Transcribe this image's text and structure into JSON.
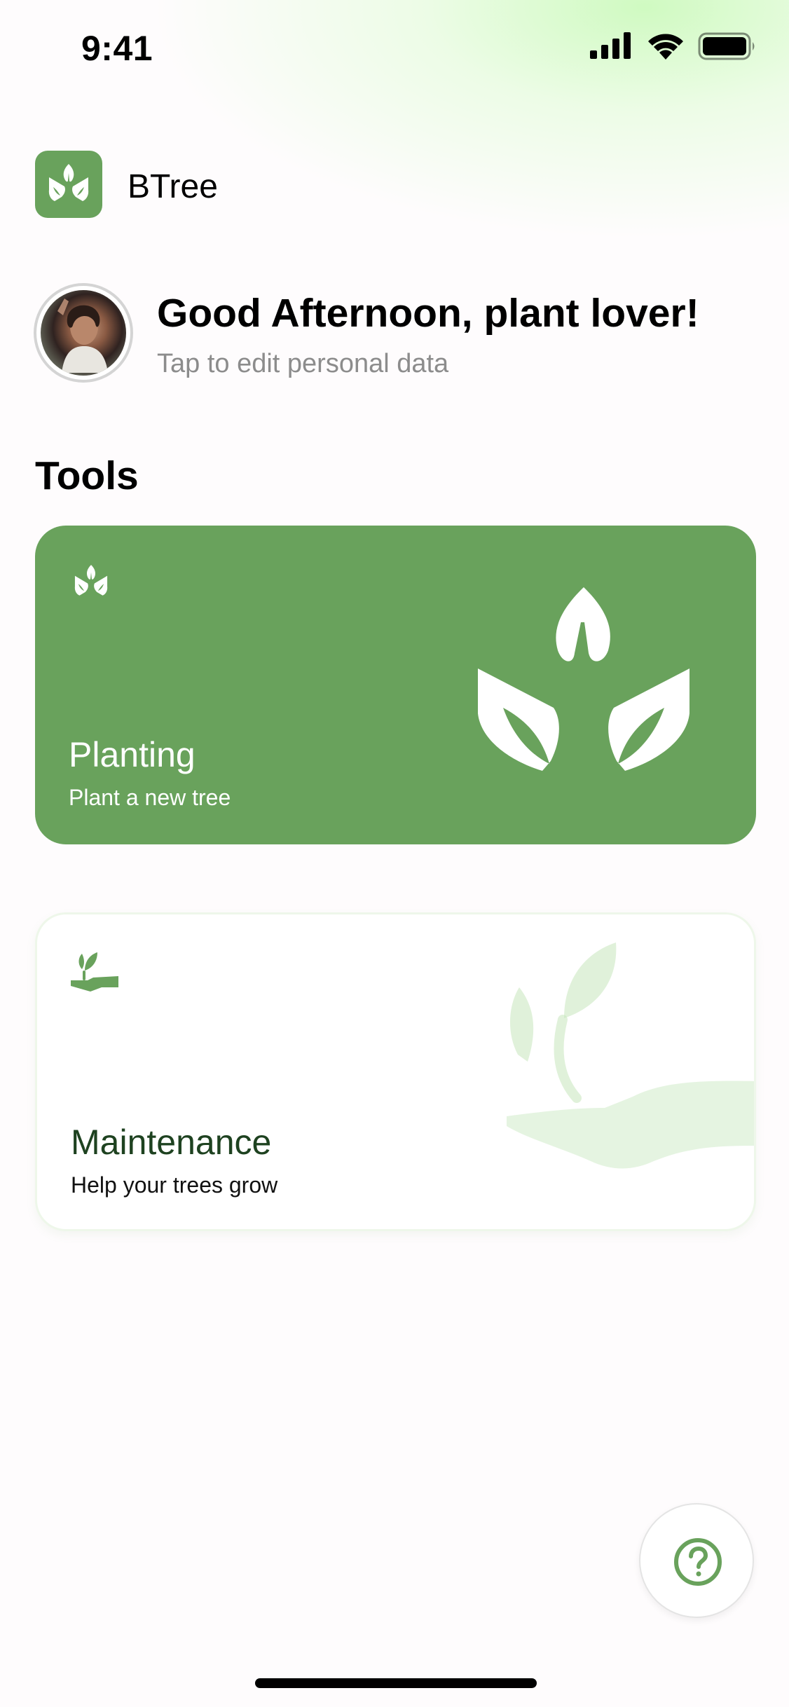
{
  "status_bar": {
    "time": "9:41",
    "icons": [
      "cellular-signal-icon",
      "wifi-icon",
      "battery-icon"
    ]
  },
  "app": {
    "name": "BTree",
    "logo_icon": "leaf-sprout-logo"
  },
  "greeting": {
    "title": "Good Afternoon, plant lover!",
    "subtitle": "Tap to edit personal data",
    "avatar": "user-avatar-photo"
  },
  "tools": {
    "heading": "Tools",
    "cards": [
      {
        "title": "Planting",
        "subtitle": "Plant a new tree",
        "icon": "leaf-sprout-icon",
        "background": "#69a25c"
      },
      {
        "title": "Maintenance",
        "subtitle": "Help your trees grow",
        "icon": "hand-sprout-icon",
        "background": "#ffffff"
      }
    ]
  },
  "help_button": {
    "icon": "question-circle-icon"
  },
  "colors": {
    "brand_green": "#69a25c",
    "dark_green_text": "#1e4220",
    "muted_text": "#8c8c8c"
  }
}
